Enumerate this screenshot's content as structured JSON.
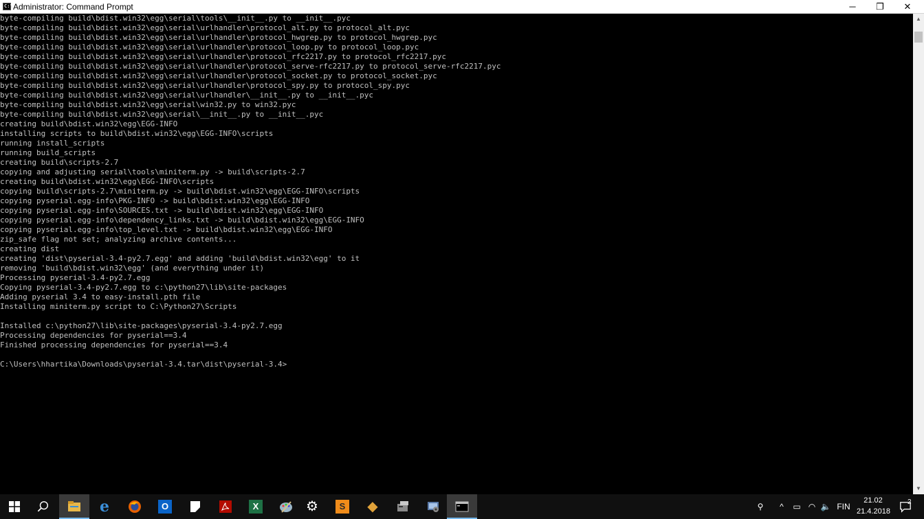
{
  "window": {
    "title": "Administrator: Command Prompt",
    "icon_label": "C:\\",
    "minimize": "─",
    "maximize": "❐",
    "close": "✕"
  },
  "console": {
    "lines": [
      "byte-compiling build\\bdist.win32\\egg\\serial\\tools\\__init__.py to __init__.pyc",
      "byte-compiling build\\bdist.win32\\egg\\serial\\urlhandler\\protocol_alt.py to protocol_alt.pyc",
      "byte-compiling build\\bdist.win32\\egg\\serial\\urlhandler\\protocol_hwgrep.py to protocol_hwgrep.pyc",
      "byte-compiling build\\bdist.win32\\egg\\serial\\urlhandler\\protocol_loop.py to protocol_loop.pyc",
      "byte-compiling build\\bdist.win32\\egg\\serial\\urlhandler\\protocol_rfc2217.py to protocol_rfc2217.pyc",
      "byte-compiling build\\bdist.win32\\egg\\serial\\urlhandler\\protocol_serve-rfc2217.py to protocol_serve-rfc2217.pyc",
      "byte-compiling build\\bdist.win32\\egg\\serial\\urlhandler\\protocol_socket.py to protocol_socket.pyc",
      "byte-compiling build\\bdist.win32\\egg\\serial\\urlhandler\\protocol_spy.py to protocol_spy.pyc",
      "byte-compiling build\\bdist.win32\\egg\\serial\\urlhandler\\__init__.py to __init__.pyc",
      "byte-compiling build\\bdist.win32\\egg\\serial\\win32.py to win32.pyc",
      "byte-compiling build\\bdist.win32\\egg\\serial\\__init__.py to __init__.pyc",
      "creating build\\bdist.win32\\egg\\EGG-INFO",
      "installing scripts to build\\bdist.win32\\egg\\EGG-INFO\\scripts",
      "running install_scripts",
      "running build_scripts",
      "creating build\\scripts-2.7",
      "copying and adjusting serial\\tools\\miniterm.py -> build\\scripts-2.7",
      "creating build\\bdist.win32\\egg\\EGG-INFO\\scripts",
      "copying build\\scripts-2.7\\miniterm.py -> build\\bdist.win32\\egg\\EGG-INFO\\scripts",
      "copying pyserial.egg-info\\PKG-INFO -> build\\bdist.win32\\egg\\EGG-INFO",
      "copying pyserial.egg-info\\SOURCES.txt -> build\\bdist.win32\\egg\\EGG-INFO",
      "copying pyserial.egg-info\\dependency_links.txt -> build\\bdist.win32\\egg\\EGG-INFO",
      "copying pyserial.egg-info\\top_level.txt -> build\\bdist.win32\\egg\\EGG-INFO",
      "zip_safe flag not set; analyzing archive contents...",
      "creating dist",
      "creating 'dist\\pyserial-3.4-py2.7.egg' and adding 'build\\bdist.win32\\egg' to it",
      "removing 'build\\bdist.win32\\egg' (and everything under it)",
      "Processing pyserial-3.4-py2.7.egg",
      "Copying pyserial-3.4-py2.7.egg to c:\\python27\\lib\\site-packages",
      "Adding pyserial 3.4 to easy-install.pth file",
      "Installing miniterm.py script to C:\\Python27\\Scripts",
      "",
      "Installed c:\\python27\\lib\\site-packages\\pyserial-3.4-py2.7.egg",
      "Processing dependencies for pyserial==3.4",
      "Finished processing dependencies for pyserial==3.4",
      "",
      "C:\\Users\\hhartika\\Downloads\\pyserial-3.4.tar\\dist\\pyserial-3.4>"
    ]
  },
  "scrollbar": {
    "up": "▲",
    "down": "▼"
  },
  "taskbar": {
    "apps": [
      {
        "name": "start-icon",
        "glyph": "",
        "color": "#ffffff"
      },
      {
        "name": "search-icon",
        "glyph": "",
        "color": "#ffffff"
      },
      {
        "name": "file-explorer-icon",
        "glyph": "",
        "color": "#e8b84a"
      },
      {
        "name": "edge-icon",
        "glyph": "e",
        "color": "#3b8fd9"
      },
      {
        "name": "firefox-icon",
        "glyph": "",
        "color": "#e66000"
      },
      {
        "name": "outlook-icon",
        "glyph": "O",
        "color": "#0a64c8"
      },
      {
        "name": "notepad-icon",
        "glyph": "",
        "color": "#ffffff"
      },
      {
        "name": "acrobat-icon",
        "glyph": "",
        "color": "#b30b00"
      },
      {
        "name": "excel-icon",
        "glyph": "X",
        "color": "#1e7145"
      },
      {
        "name": "paint-icon",
        "glyph": "",
        "color": "#9bb7c8"
      },
      {
        "name": "settings-icon",
        "glyph": "⚙",
        "color": "#ffffff"
      },
      {
        "name": "sublime-text-icon",
        "glyph": "S",
        "color": "#f08c1a"
      },
      {
        "name": "git-icon",
        "glyph": "◆",
        "color": "#2e6da4"
      },
      {
        "name": "device-manager-icon",
        "glyph": "",
        "color": "#8a8a8a"
      },
      {
        "name": "control-panel-icon",
        "glyph": "",
        "color": "#5a7aa8"
      },
      {
        "name": "command-prompt-icon",
        "glyph": "",
        "color": "#c0c0c0"
      }
    ],
    "tray": {
      "people": "⚲",
      "chevron": "^",
      "battery": "▭",
      "wifi": "◠",
      "volume": "🔈",
      "language": "FIN",
      "time": "21.02",
      "date": "21.4.2018",
      "notifications_count": "2"
    }
  }
}
